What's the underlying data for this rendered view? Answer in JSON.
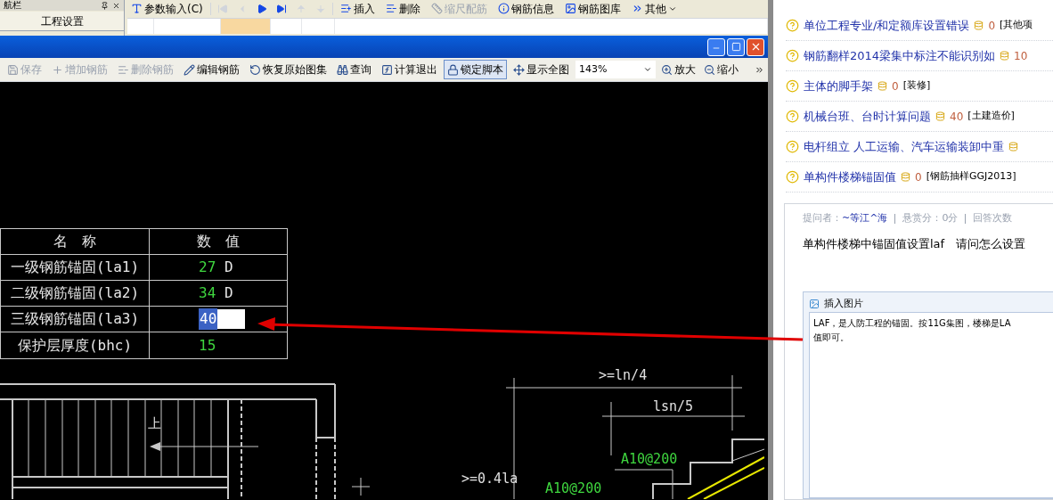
{
  "nav_panel": {
    "title": "航栏",
    "button": "工程设置"
  },
  "top_toolbar": [
    {
      "label": "参数输入(C)",
      "disabled": false
    },
    {
      "label": "插入",
      "disabled": false
    },
    {
      "label": "删除",
      "disabled": false
    },
    {
      "label": "缩尺配筋",
      "disabled": true
    },
    {
      "label": "钢筋信息",
      "disabled": false
    },
    {
      "label": "钢筋图库",
      "disabled": false
    },
    {
      "label": "其他",
      "disabled": false
    }
  ],
  "nav_buttons": [
    {
      "disabled": true
    },
    {
      "disabled": true
    },
    {
      "disabled": false
    },
    {
      "disabled": false
    },
    {
      "disabled": true
    },
    {
      "disabled": true
    }
  ],
  "grid_cells": [
    {
      "selected": false
    },
    {
      "selected": false
    },
    {
      "selected": true
    },
    {
      "selected": false
    },
    {
      "selected": false
    },
    {
      "selected": false
    }
  ],
  "window_toolbar": [
    {
      "label": "保存",
      "disabled": true,
      "pressed": false
    },
    {
      "label": "增加钢筋",
      "disabled": true,
      "pressed": false
    },
    {
      "label": "删除钢筋",
      "disabled": true,
      "pressed": false
    },
    {
      "label": "编辑钢筋",
      "disabled": false,
      "pressed": false
    },
    {
      "label": "恢复原始图集",
      "disabled": false,
      "pressed": false
    },
    {
      "label": "查询",
      "disabled": false,
      "pressed": false
    },
    {
      "label": "计算退出",
      "disabled": false,
      "pressed": false
    },
    {
      "label": "锁定脚本",
      "disabled": false,
      "pressed": true
    },
    {
      "label": "显示全图",
      "disabled": false,
      "pressed": false
    }
  ],
  "zoom": {
    "value": "143%"
  },
  "zoom_buttons": [
    "放大",
    "缩小"
  ],
  "parameter_table": {
    "columns": [
      "名　称",
      "数　值"
    ],
    "rows": [
      {
        "name": "一级钢筋锚固(la1)",
        "value": "27",
        "unit": "D",
        "editing": false
      },
      {
        "name": "二级钢筋锚固(la2)",
        "value": "34",
        "unit": "D",
        "editing": false
      },
      {
        "name": "三级钢筋锚固(la3)",
        "value": "40",
        "editing": true
      },
      {
        "name": "保护层厚度(bhc)",
        "value": "15",
        "editing": false
      }
    ]
  },
  "drawing_labels": [
    {
      "text": ">=ln/4",
      "kind": "dimension"
    },
    {
      "text": "lsn/5",
      "kind": "dimension"
    },
    {
      "text": "A10@200",
      "kind": "rebar"
    },
    {
      "text": ">=0.4la",
      "kind": "dimension"
    },
    {
      "text": "A10@200",
      "kind": "rebar"
    },
    {
      "text": "上",
      "kind": "direction"
    }
  ],
  "questions": [
    {
      "title": "单位工程专业/和定额库设置错误",
      "score": "0",
      "tag": "[其他项"
    },
    {
      "title": "钢筋翻样2014梁集中标注不能识别如",
      "score": "10"
    },
    {
      "title": "主体的脚手架",
      "score": "0",
      "tag": "[装修]"
    },
    {
      "title": "机械台班、台时计算问题",
      "score": "40",
      "tag": "[土建造价]"
    },
    {
      "title": "电杆组立 人工运输、汽车运输装卸中重"
    },
    {
      "title": "单构件楼梯锚固值",
      "score": "0",
      "tag": "[钢筋抽样GGJ2013]"
    }
  ],
  "question_detail": {
    "asker_label": "提问者：",
    "asker": "~等江^海",
    "reward": "悬赏分：0分",
    "answers_label": "回答次数",
    "body": "单构件楼梯中锚固值设置laf　请问怎么设置"
  },
  "editor": {
    "toolbar_button": "插入图片",
    "lines": [
      "LAF，是人防工程的锚固。按11G集图，楼梯是LA",
      "值即可。"
    ]
  }
}
